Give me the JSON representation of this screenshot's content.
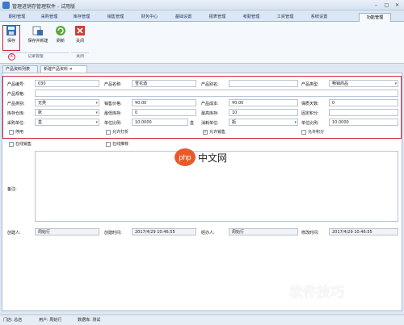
{
  "window": {
    "title": "管理进销存管理软件 - 试用版",
    "minimize": "–",
    "maximize": "□",
    "close": "✕"
  },
  "menu": {
    "tabs": [
      "期初管理",
      "采购管理",
      "库存管理",
      "销售管理",
      "财务中心",
      "基础设置",
      "报表管理",
      "考勤管理",
      "工资管理",
      "系统设置",
      "功能管理"
    ]
  },
  "ribbon": {
    "buttons": [
      {
        "label": "保存"
      },
      {
        "label": "保存并新建"
      },
      {
        "label": "刷新"
      },
      {
        "label": "关闭"
      }
    ],
    "groups": [
      "记录管理",
      "关闭"
    ],
    "markers": [
      "②",
      "①"
    ]
  },
  "doc_tabs": [
    "产品资料列表",
    "新建产品资料"
  ],
  "form": {
    "row1": {
      "code_label": "产品编号:",
      "code_value": "030",
      "name_label": "产品名称:",
      "name_value": "雪花酒",
      "alias_label": "产品别名:",
      "alias_value": "",
      "type_label": "产品类型:",
      "type_value": "畅销商品"
    },
    "row2": {
      "spec_label": "产品规格:",
      "spec_value": ""
    },
    "row3": {
      "category_label": "产品类别:",
      "category_value": "无类",
      "sale_price_label": "销售价格:",
      "sale_price_value": "¥0.00",
      "cost_label": "产品成本:",
      "cost_value": "¥0.00",
      "shelf_label": "保质天数:",
      "shelf_value": "0"
    },
    "row4": {
      "warehouse_label": "库存仓库:",
      "warehouse_value": "默",
      "min_stock_label": "最低库存:",
      "min_stock_value": "0",
      "max_stock_label": "最高库存:",
      "max_stock_value": "10",
      "fixed_points_label": "固定积分:",
      "fixed_points_value": ""
    },
    "row5": {
      "unit_label": "采购单位:",
      "unit_value": "盒",
      "ratio_label": "单位比例:",
      "ratio_value": "10.0000",
      "ratio_unit": "盒",
      "sale_unit_label": "消耗单位:",
      "sale_unit_value": "瓶",
      "ratio2_label": "单位比例:",
      "ratio2_value": "10.0000"
    },
    "checks_row1": [
      "停用",
      "允许打折",
      "允许销售",
      "允许积分"
    ],
    "checks_row2": [
      "在线销售",
      "在线推荐"
    ],
    "remark_label": "备注:",
    "footer": {
      "creator_label": "创建人:",
      "creator_value": "周始行",
      "created_label": "创建时间:",
      "created_value": "2017/4/29 10:46:55",
      "editor_label": "经办人:",
      "editor_value": "周始行",
      "edited_label": "修改时间:",
      "edited_value": "2017/4/29 10:46:55"
    }
  },
  "status": {
    "items": [
      "门店: 总店",
      "用户: 周始行",
      "数据库: 测试"
    ]
  },
  "watermarks": {
    "logo_text": "中文网",
    "logo_badge": "php",
    "corner_text": "软件技巧"
  },
  "colors": {
    "highlight": "#d0243c",
    "ribbon_bg": "#f5f9fd",
    "accent": "#3a7bc8"
  }
}
